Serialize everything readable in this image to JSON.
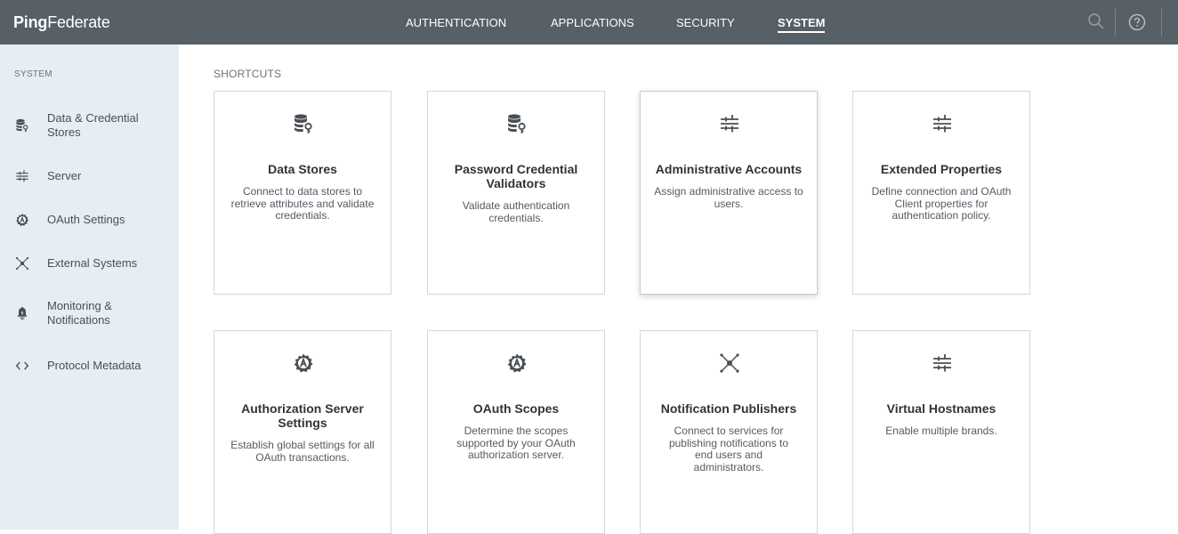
{
  "app": {
    "logo_bold": "Ping",
    "logo_rest": "Federate"
  },
  "nav": {
    "authentication": "AUTHENTICATION",
    "applications": "APPLICATIONS",
    "security": "SECURITY",
    "system": "SYSTEM"
  },
  "colors": {
    "topbar": "#575f67",
    "sidebar": "#e6eef4",
    "icon": "#4a4f54"
  },
  "sidebar": {
    "title": "SYSTEM",
    "items": [
      {
        "label": "Data & Credential Stores",
        "icon": "database-key-icon"
      },
      {
        "label": "Server",
        "icon": "sliders-icon"
      },
      {
        "label": "OAuth Settings",
        "icon": "oauth-gear-icon"
      },
      {
        "label": "External Systems",
        "icon": "network-icon"
      },
      {
        "label": "Monitoring & Notifications",
        "icon": "bell-icon"
      },
      {
        "label": "Protocol Metadata",
        "icon": "code-brackets-icon"
      }
    ]
  },
  "main": {
    "title": "SHORTCUTS",
    "cards": [
      {
        "title": "Data Stores",
        "desc": "Connect to data stores to retrieve attributes and validate credentials.",
        "icon": "database-key-icon"
      },
      {
        "title": "Password Credential Validators",
        "desc": "Validate authentication credentials.",
        "icon": "database-key-icon"
      },
      {
        "title": "Administrative Accounts",
        "desc": "Assign administrative access to users.",
        "icon": "sliders-icon"
      },
      {
        "title": "Extended Properties",
        "desc": "Define connection and OAuth Client properties for authentication policy.",
        "icon": "sliders-icon"
      },
      {
        "title": "Authorization Server Settings",
        "desc": "Establish global settings for all OAuth transactions.",
        "icon": "oauth-gear-icon"
      },
      {
        "title": "OAuth Scopes",
        "desc": "Determine the scopes supported by your OAuth authorization server.",
        "icon": "oauth-gear-icon"
      },
      {
        "title": "Notification Publishers",
        "desc": "Connect to services for publishing notifications to end users and administrators.",
        "icon": "network-icon"
      },
      {
        "title": "Virtual Hostnames",
        "desc": "Enable multiple brands.",
        "icon": "sliders-icon"
      }
    ]
  },
  "toolbar": {
    "search_icon": "search-icon",
    "help_icon": "help-icon"
  }
}
